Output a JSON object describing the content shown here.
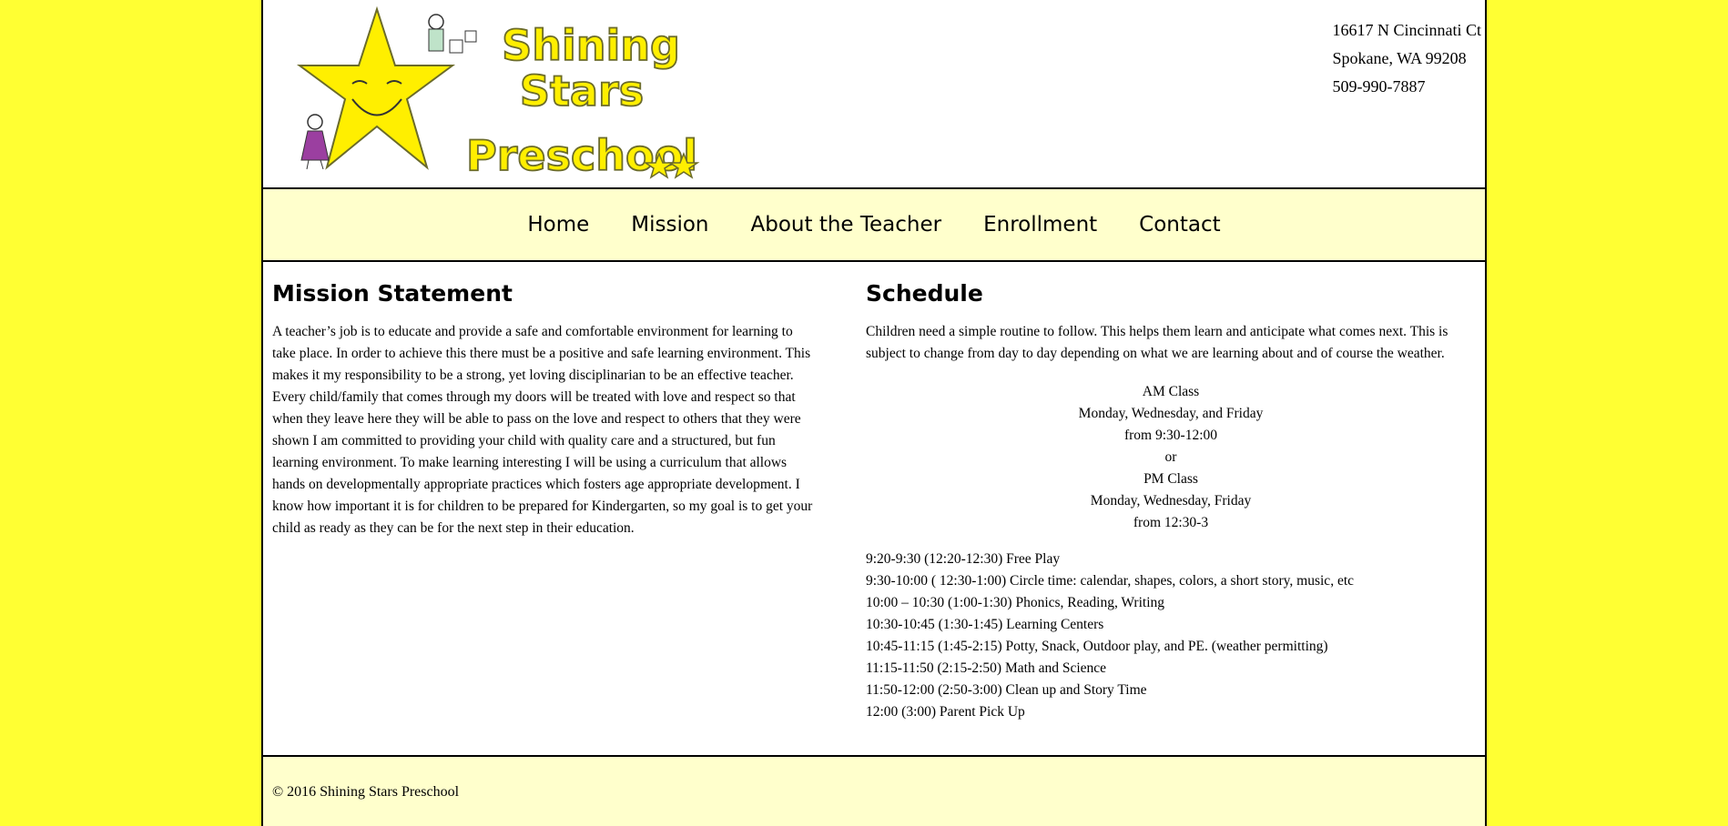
{
  "logo": {
    "line1": "Shining",
    "line2": "Stars",
    "line3": "Preschool",
    "colors": {
      "logo_fill": "#ffef00",
      "logo_stroke": "#6b6b2a",
      "girl_dress": "#9b3fa0"
    }
  },
  "address": {
    "street": "16617 N Cincinnati Ct",
    "city": "Spokane, WA 99208",
    "phone": "509-990-7887"
  },
  "nav": {
    "items": [
      {
        "label": "Home"
      },
      {
        "label": "Mission"
      },
      {
        "label": "About the Teacher"
      },
      {
        "label": "Enrollment"
      },
      {
        "label": "Contact"
      }
    ]
  },
  "mission": {
    "title": "Mission Statement",
    "text": "A teacher’s job is to educate and provide a safe and comfortable environment for learning to take place. In order to achieve this there must be a positive and safe learning environment. This makes it my responsibility to be a strong, yet loving disciplinarian to be an effective teacher. Every child/family that comes through my doors will be treated with love and respect so that when they leave here they will be able to pass on the love and respect to others that they were shown I am committed to providing your child with quality care and a structured, but fun learning environment. To make learning interesting I will be using a curriculum that allows hands on developmentally appropriate practices which fosters age appropriate development. I know how important it is for children to be prepared for Kindergarten, so my goal is to get your child as ready as they can be for the next step in their education."
  },
  "schedule": {
    "title": "Schedule",
    "intro": "Children need a simple routine to follow. This helps them learn and anticipate what comes next. This is subject to change from day to day depending on what we are learning about and of course the weather.",
    "classes": [
      "AM Class",
      "Monday, Wednesday, and Friday",
      "from 9:30-12:00",
      "or",
      "PM Class",
      "Monday, Wednesday, Friday",
      "from 12:30-3"
    ],
    "items": [
      "9:20-9:30 (12:20-12:30) Free Play",
      "9:30-10:00 ( 12:30-1:00) Circle time: calendar, shapes, colors, a short story, music, etc",
      "10:00 – 10:30 (1:00-1:30) Phonics, Reading, Writing",
      "10:30-10:45 (1:30-1:45) Learning Centers",
      "10:45-11:15 (1:45-2:15) Potty, Snack, Outdoor play, and PE. (weather permitting)",
      "11:15-11:50 (2:15-2:50) Math and Science",
      "11:50-12:00 (2:50-3:00) Clean up and Story Time",
      "12:00 (3:00) Parent Pick Up"
    ]
  },
  "footer": {
    "copyright": "© 2016 Shining Stars Preschool"
  },
  "colors": {
    "background": "#ffff33",
    "nav_background": "#ffffcc",
    "footer_background": "#ffffcc"
  }
}
